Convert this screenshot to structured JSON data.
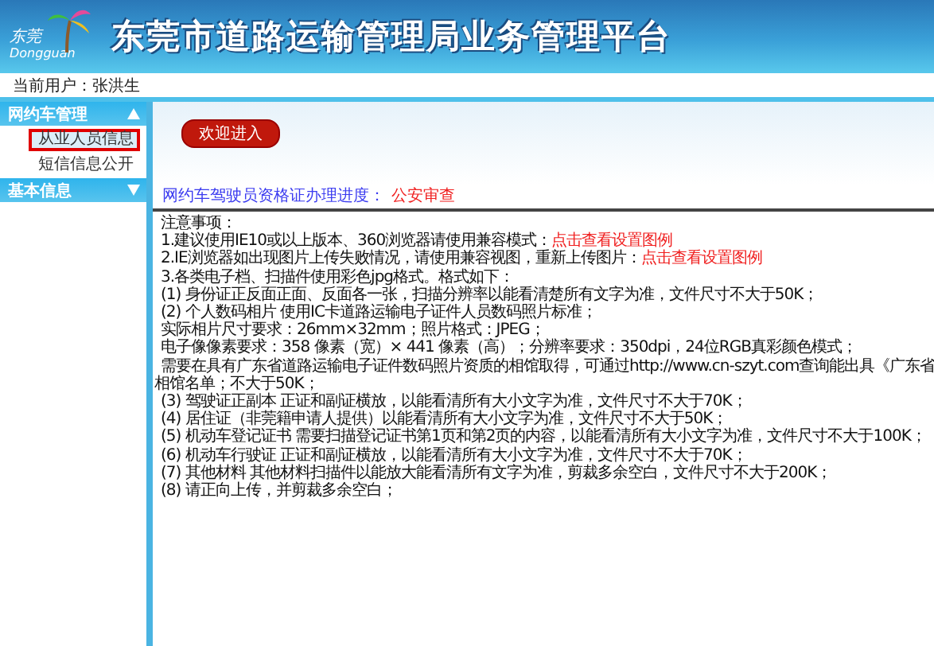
{
  "header": {
    "logo_text": "东莞",
    "logo_subtext": "Dongguan",
    "title": "东莞市道路运输管理局业务管理平台"
  },
  "user_bar": {
    "label": "当前用户：张洪生"
  },
  "sidebar": {
    "sections": [
      {
        "title": "网约车管理",
        "expanded": true,
        "items": [
          {
            "label": "从业人员信息",
            "selected": true
          },
          {
            "label": "短信信息公开",
            "selected": false
          }
        ]
      },
      {
        "title": "基本信息",
        "expanded": false
      }
    ]
  },
  "main": {
    "welcome": "欢迎进入",
    "progress": {
      "label": "网约车驾驶员资格证办理进度：",
      "value": "公安审查"
    },
    "notes": [
      {
        "kind": "title",
        "text": "注意事项："
      },
      {
        "kind": "item",
        "text": "1.建议使用IE10或以上版本、360浏览器请使用兼容模式：",
        "link": "点击查看设置图例"
      },
      {
        "kind": "item",
        "text": "2.IE浏览器如出现图片上传失败情况，请使用兼容视图，重新上传图片：",
        "link": "点击查看设置图例"
      },
      {
        "kind": "item",
        "text": "3.各类电子档、扫描件使用彩色jpg格式。格式如下："
      },
      {
        "kind": "item",
        "text": "(1) 身份证正反面正面、反面各一张，扫描分辨率以能看清楚所有文字为准，文件尺寸不大于50K；"
      },
      {
        "kind": "item",
        "text": "(2) 个人数码相片 使用IC卡道路运输电子证件人员数码照片标准；"
      },
      {
        "kind": "item",
        "text": "实际相片尺寸要求：26mm×32mm；照片格式：JPEG；"
      },
      {
        "kind": "item",
        "text": "电子像像素要求：358 像素（宽）× 441 像素（高）；分辨率要求：350dpi，24位RGB真彩颜色模式；"
      },
      {
        "kind": "item",
        "text": "需要在具有广东省道路运输电子证件数码照片资质的相馆取得，可通过http://www.cn-szyt.com查询能出具《广东省"
      },
      {
        "kind": "wrap",
        "text": "相馆名单；不大于50K；"
      },
      {
        "kind": "item",
        "text": "(3) 驾驶证正副本 正证和副证横放，以能看清所有大小文字为准，文件尺寸不大于70K；"
      },
      {
        "kind": "item",
        "text": "(4) 居住证（非莞籍申请人提供）以能看清所有大小文字为准，文件尺寸不大于50K；"
      },
      {
        "kind": "item",
        "text": "(5) 机动车登记证书 需要扫描登记证书第1页和第2页的内容，以能看清所有大小文字为准，文件尺寸不大于100K；"
      },
      {
        "kind": "item",
        "text": "(6) 机动车行驶证 正证和副证横放，以能看清所有大小文字为准，文件尺寸不大于70K；"
      },
      {
        "kind": "item",
        "text": "(7) 其他材料 其他材料扫描件以能放大能看清所有文字为准，剪裁多余空白，文件尺寸不大于200K；"
      },
      {
        "kind": "item",
        "text": "(8) 请正向上传，并剪裁多余空白；"
      }
    ]
  }
}
